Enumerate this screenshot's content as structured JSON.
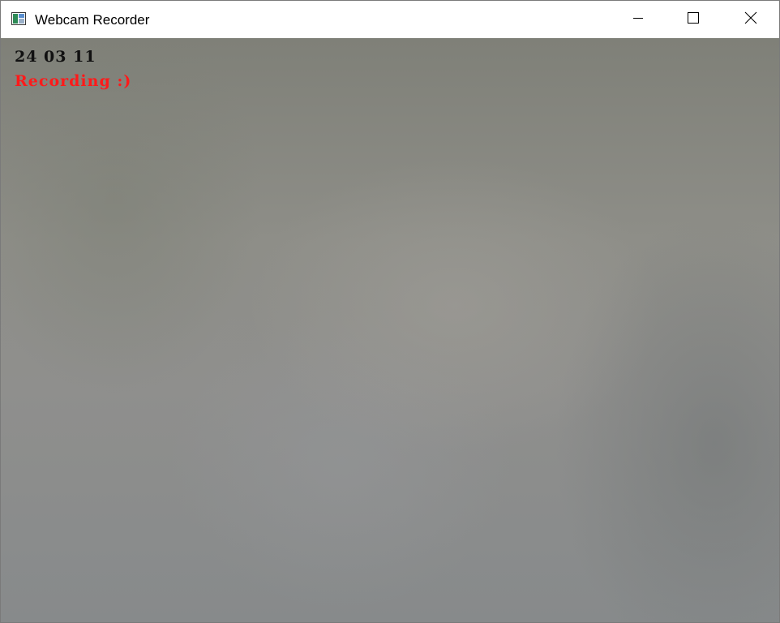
{
  "window": {
    "title": "Webcam Recorder",
    "icon": "app-window-icon",
    "controls": {
      "minimize_icon": "minimize-icon",
      "maximize_icon": "maximize-icon",
      "close_icon": "close-icon"
    }
  },
  "video": {
    "overlay_date": "24 03 11",
    "overlay_status": "Recording :)",
    "status_color": "#ff1a1a",
    "date_color": "#111111"
  }
}
